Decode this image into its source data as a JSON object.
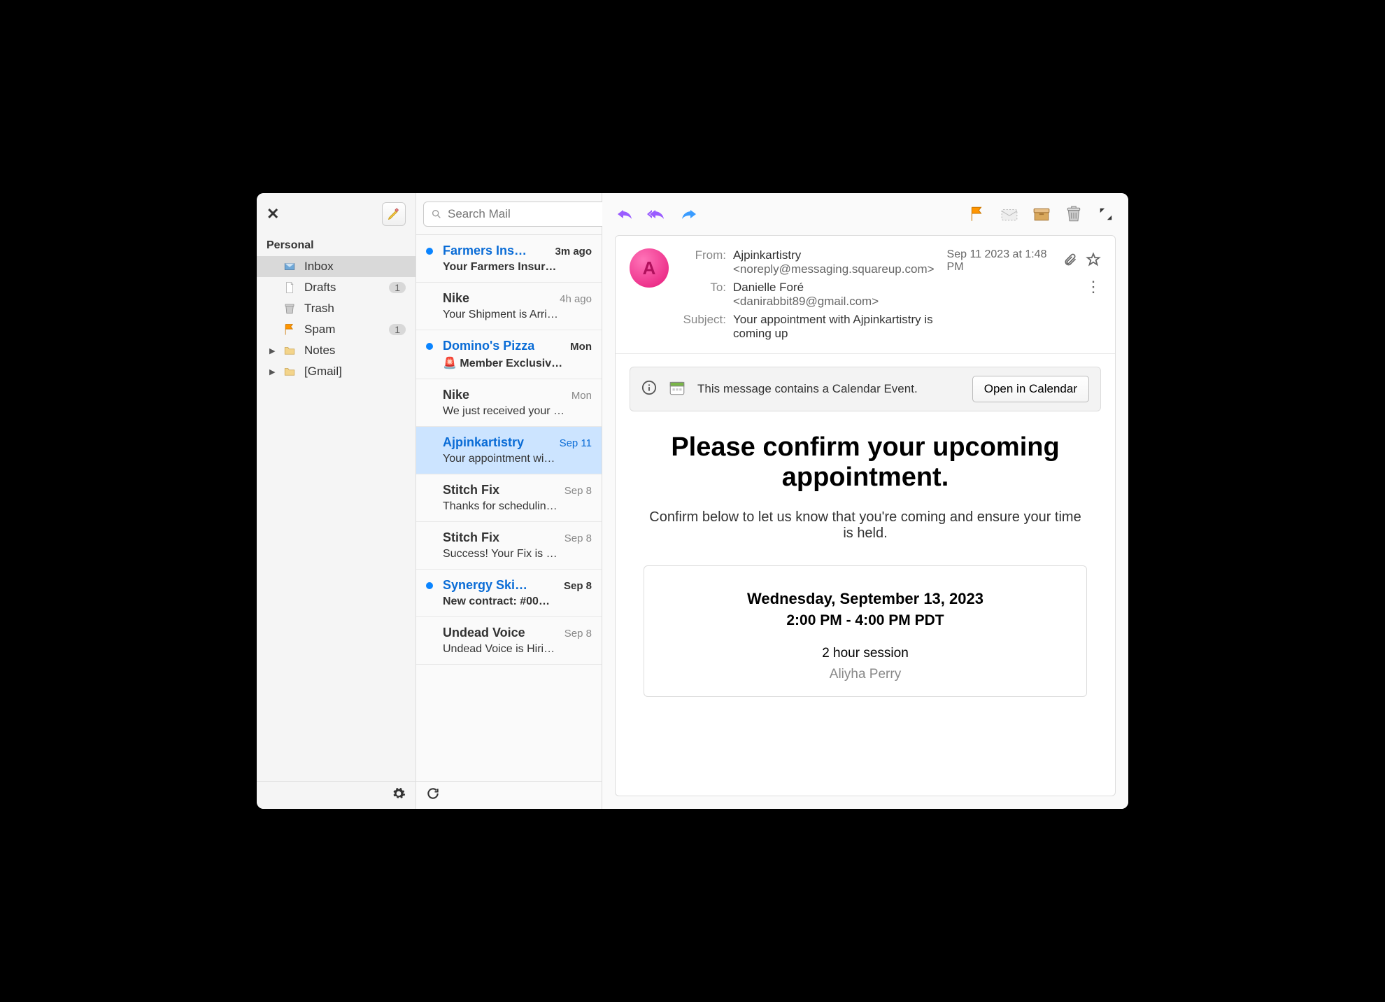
{
  "account_label": "Personal",
  "search": {
    "placeholder": "Search Mail"
  },
  "folders": [
    {
      "name": "Inbox",
      "icon": "inbox",
      "selected": true,
      "count": "",
      "expandable": false
    },
    {
      "name": "Drafts",
      "icon": "file",
      "selected": false,
      "count": "1",
      "expandable": false
    },
    {
      "name": "Trash",
      "icon": "trash",
      "selected": false,
      "count": "",
      "expandable": false
    },
    {
      "name": "Spam",
      "icon": "flag",
      "selected": false,
      "count": "1",
      "expandable": false
    },
    {
      "name": "Notes",
      "icon": "folder",
      "selected": false,
      "count": "",
      "expandable": true
    },
    {
      "name": "[Gmail]",
      "icon": "folder",
      "selected": false,
      "count": "",
      "expandable": true
    }
  ],
  "messages": [
    {
      "sender": "Farmers Ins…",
      "date": "3m ago",
      "subject": "Your Farmers Insur…",
      "unread": true,
      "selected": false
    },
    {
      "sender": "Nike",
      "date": "4h ago",
      "subject": "Your Shipment is Arri…",
      "unread": false,
      "selected": false
    },
    {
      "sender": "Domino's Pizza",
      "date": "Mon",
      "subject": "🚨 Member Exclusiv…",
      "unread": true,
      "selected": false
    },
    {
      "sender": "Nike",
      "date": "Mon",
      "subject": "We just received your …",
      "unread": false,
      "selected": false
    },
    {
      "sender": "Ajpinkartistry",
      "date": "Sep 11",
      "subject": "Your appointment wi…",
      "unread": false,
      "selected": true
    },
    {
      "sender": "Stitch Fix",
      "date": "Sep  8",
      "subject": "Thanks for schedulin…",
      "unread": false,
      "selected": false
    },
    {
      "sender": "Stitch Fix",
      "date": "Sep  8",
      "subject": "Success! Your Fix is …",
      "unread": false,
      "selected": false
    },
    {
      "sender": "Synergy Ski…",
      "date": "Sep  8",
      "subject": "New contract: #00…",
      "unread": true,
      "selected": false
    },
    {
      "sender": "Undead Voice",
      "date": "Sep  8",
      "subject": "Undead Voice is Hiri…",
      "unread": false,
      "selected": false
    }
  ],
  "reader": {
    "avatar_letter": "A",
    "from_label": "From:",
    "from_name": "Ajpinkartistry",
    "from_addr": "<noreply@messaging.squareup.com>",
    "to_label": "To:",
    "to_name": "Danielle Foré",
    "to_addr": "<danirabbit89@gmail.com>",
    "subject_label": "Subject:",
    "subject": "Your appointment with Ajpinkartistry is coming up",
    "timestamp": "Sep 11 2023 at 1:48 PM",
    "banner_text": "This message contains a Calendar Event.",
    "banner_button": "Open in Calendar",
    "body_heading": "Please confirm your upcoming appointment.",
    "body_sub": "Confirm below to let us know that you're coming and ensure your time is held.",
    "appt_date": "Wednesday, September 13, 2023",
    "appt_time": "2:00 PM - 4:00 PM PDT",
    "appt_duration": "2 hour session",
    "appt_person": "Aliyha Perry"
  }
}
